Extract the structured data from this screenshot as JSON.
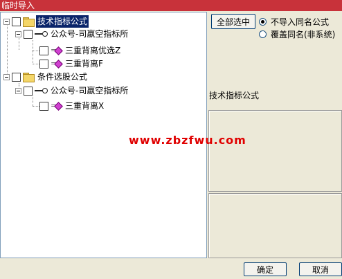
{
  "window": {
    "title": "临时导入"
  },
  "tree": {
    "items": [
      {
        "label": "技术指标公式",
        "selected": true
      },
      {
        "label": "公众号-司嬴空指标所"
      },
      {
        "label": "三重背离优选Z"
      },
      {
        "label": "三重背离F"
      },
      {
        "label": "条件选股公式"
      },
      {
        "label": "公众号-司嬴空指标所"
      },
      {
        "label": "三重背离X"
      }
    ]
  },
  "options": {
    "select_all_label": "全部选中",
    "radio_no_import": "不导入同名公式",
    "radio_overwrite": "覆盖同名(非系统)"
  },
  "info": {
    "section_label": "技术指标公式"
  },
  "watermark": {
    "text": "www.zbzfwu.com"
  },
  "footer": {
    "ok_label": "确定",
    "cancel_label": "取消"
  },
  "colors": {
    "titlebar": "#c8323a",
    "selection": "#0a246a",
    "watermark": "#e00000"
  }
}
